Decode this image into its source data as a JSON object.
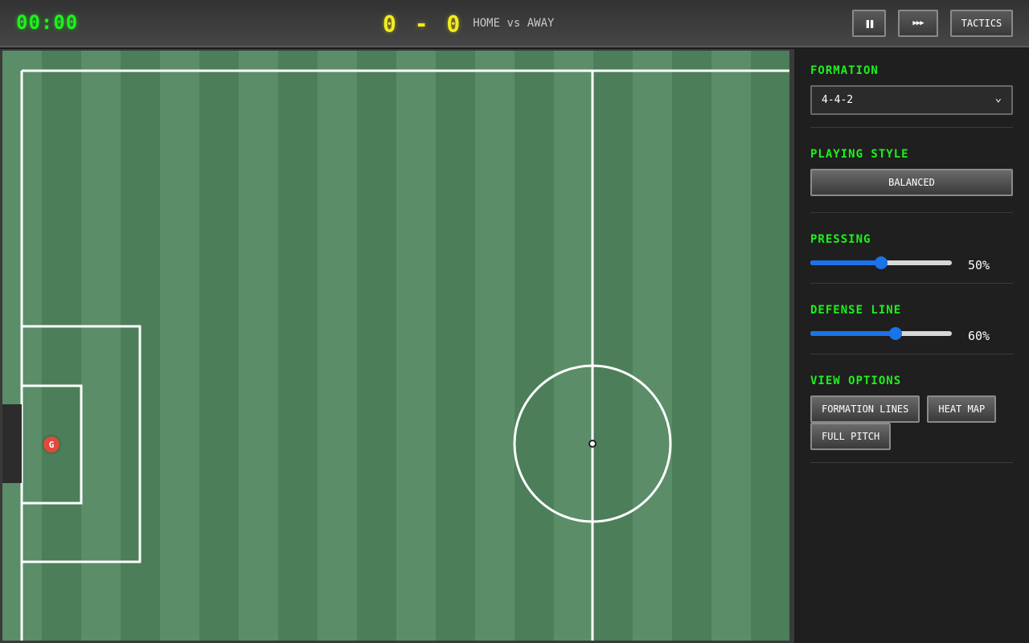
{
  "header": {
    "clock": "00:00",
    "score": "0 - 0",
    "teams": "HOME vs AWAY",
    "pause_icon": "pause-icon",
    "fast_forward_icon": "fast-forward-icon",
    "pause_glyph": "❚❚",
    "fast_forward_glyph": "▶▶▶",
    "tactics_label": "TACTICS"
  },
  "pitch": {
    "goalkeeper_label": "G",
    "colors": {
      "stripe_light": "#5a8d68",
      "stripe_dark": "#4b7e59",
      "lines": "#ffffff",
      "player": "#e04a3c"
    }
  },
  "panel": {
    "formation": {
      "title": "FORMATION",
      "selected": "4-4-2",
      "chevron": "⌄"
    },
    "playing_style": {
      "title": "PLAYING STYLE",
      "value": "BALANCED"
    },
    "pressing": {
      "title": "PRESSING",
      "value": 50,
      "display": "50%"
    },
    "defense_line": {
      "title": "DEFENSE LINE",
      "value": 60,
      "display": "60%"
    },
    "view_options": {
      "title": "VIEW OPTIONS",
      "buttons": [
        "FORMATION LINES",
        "HEAT MAP",
        "FULL PITCH"
      ]
    },
    "colors": {
      "accent": "#1cf21c",
      "slider": "#1a73e8"
    }
  }
}
